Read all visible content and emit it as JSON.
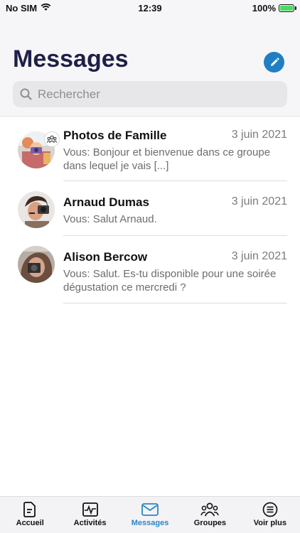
{
  "status": {
    "carrier": "No SIM",
    "time": "12:39",
    "battery": "100%",
    "battery_level": 1.0
  },
  "header": {
    "title": "Messages"
  },
  "search": {
    "placeholder": "Rechercher"
  },
  "conversations": [
    {
      "name": "Photos de Famille",
      "date": "3 juin 2021",
      "preview": "Vous: Bonjour et bienvenue dans ce groupe dans lequel je vais [...]",
      "is_group": true
    },
    {
      "name": "Arnaud Dumas",
      "date": "3 juin 2021",
      "preview": "Vous: Salut Arnaud.",
      "is_group": false
    },
    {
      "name": "Alison Bercow",
      "date": "3 juin 2021",
      "preview": "Vous: Salut. Es-tu disponible pour une soirée dégustation ce mercredi ?",
      "is_group": false
    }
  ],
  "tabs": [
    {
      "label": "Accueil",
      "icon": "document-icon",
      "active": false
    },
    {
      "label": "Activités",
      "icon": "activity-icon",
      "active": false
    },
    {
      "label": "Messages",
      "icon": "mail-icon",
      "active": true
    },
    {
      "label": "Groupes",
      "icon": "people-icon",
      "active": false
    },
    {
      "label": "Voir plus",
      "icon": "menu-icon",
      "active": false
    }
  ],
  "colors": {
    "accent": "#1f7ec4",
    "title": "#1f2048",
    "active_tab": "#2a86c9"
  }
}
